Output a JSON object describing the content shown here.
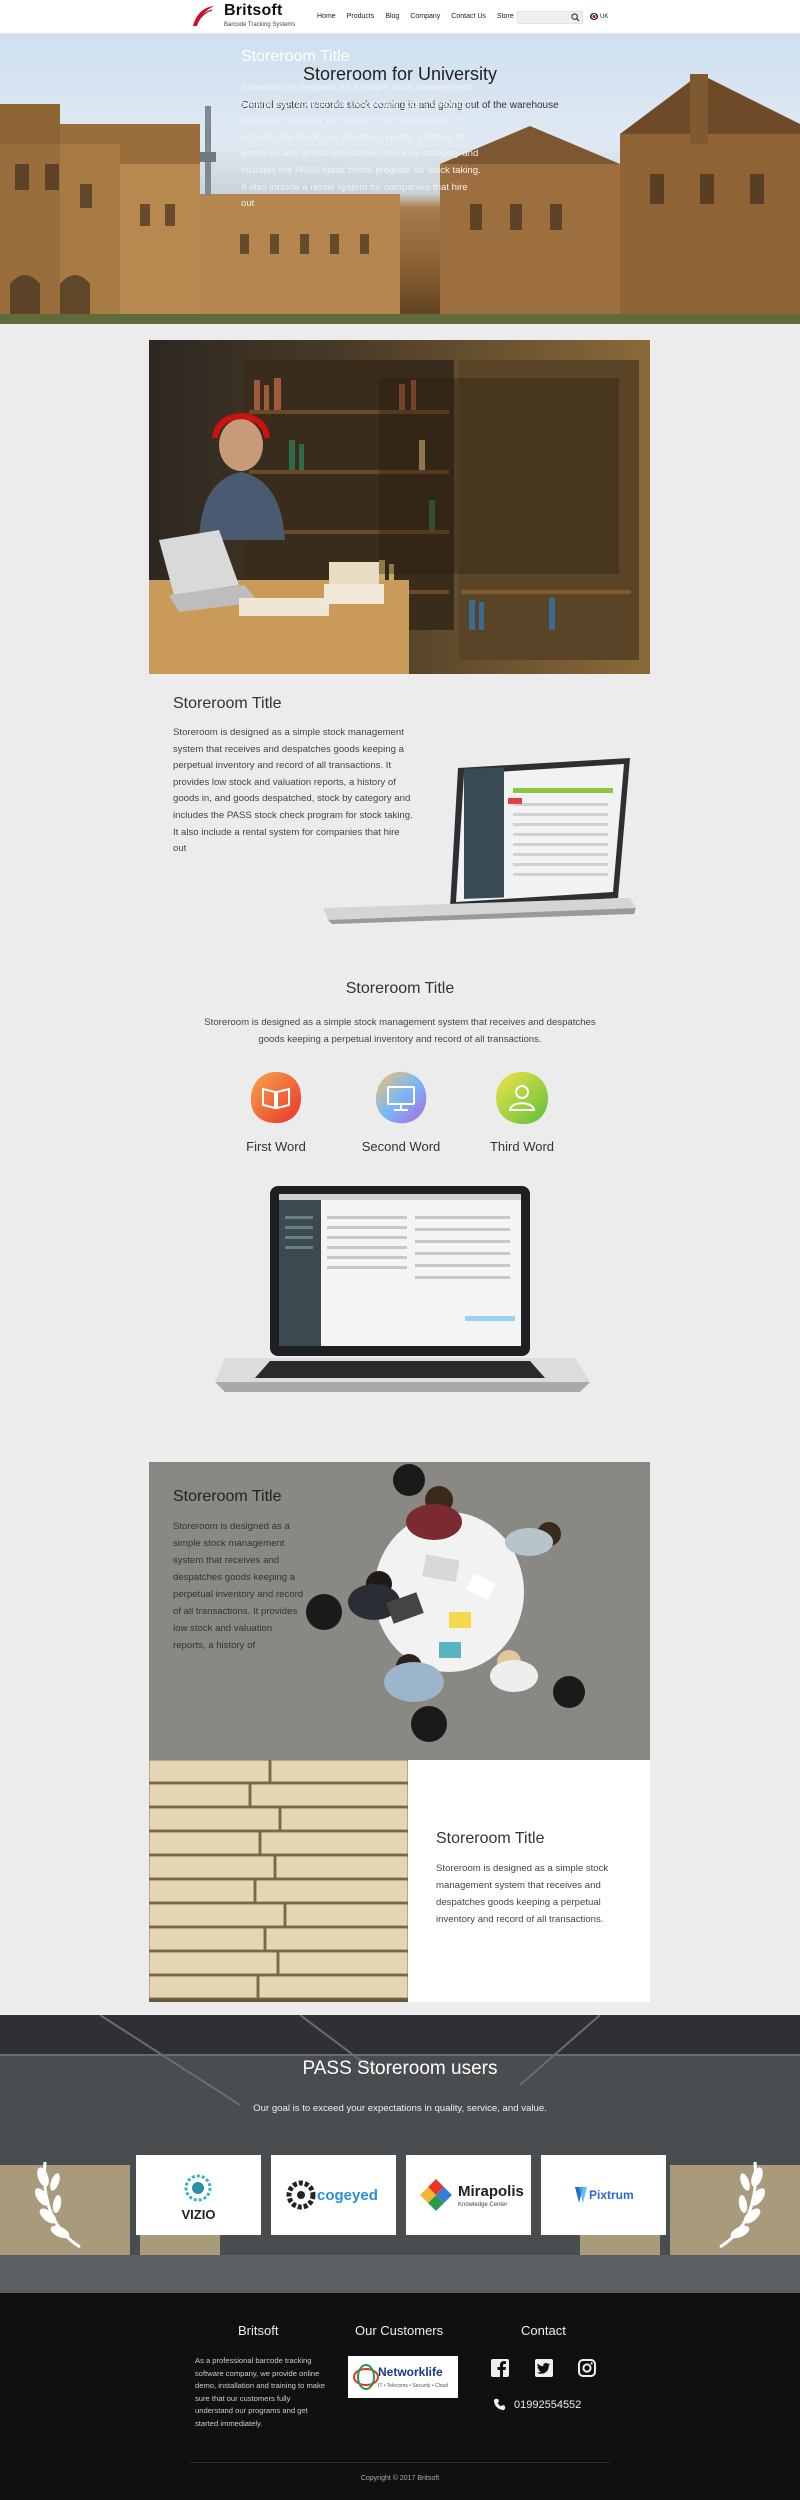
{
  "brand": {
    "name": "Britsoft",
    "tagline": "Barcode Tracking Systems"
  },
  "nav": {
    "links": [
      "Home",
      "Products",
      "Blog",
      "Company",
      "Contact Us",
      "Store"
    ],
    "search_placeholder": "",
    "language": "UK"
  },
  "hero": {
    "title": "Storeroom for University",
    "subtitle": "Control system records stock coming in and going out of the warehouse"
  },
  "section1": {
    "title": "Storeroom Title",
    "text": "Storeroom is designed as a simple stock management system that receives and despatches goods keeping a perpetual inventory and record of all transactions. It provides low stock and valuation reports, a history of goods in, and goods despatched, stock by category and includes the PASS stock check program for stock taking. It also include a rental system for companies that hire out"
  },
  "section2": {
    "title": "Storeroom Title",
    "text": "Storeroom is designed as a simple stock management system that receives and despatches goods keeping a perpetual inventory and record of all transactions. It provides low stock and valuation reports, a history of goods in, and goods despatched, stock by category and includes the PASS stock check program for stock taking. It also include a rental system for companies that hire out"
  },
  "section3": {
    "title": "Storeroom Title",
    "text": "Storeroom is designed as a simple stock management system that receives and despatches goods keeping a perpetual inventory and record of all transactions.",
    "features": [
      {
        "label": "First Word",
        "icon": "book-icon",
        "color": "#f0572a"
      },
      {
        "label": "Second Word",
        "icon": "monitor-icon",
        "color": "#6aa8f0"
      },
      {
        "label": "Third Word",
        "icon": "user-icon",
        "color": "#8cc63f"
      }
    ]
  },
  "section4": {
    "title": "Storeroom Title",
    "text": "Storeroom is designed as a simple stock management system that receives and despatches goods keeping a perpetual inventory and record of all transactions. It provides low stock and valuation reports, a history of"
  },
  "section5": {
    "title": "Storeroom Title",
    "text": "Storeroom is designed as a simple stock management system that receives and despatches goods keeping a perpetual inventory and record of all transactions."
  },
  "users": {
    "title": "PASS Storeroom users",
    "subtitle": "Our goal is to exceed your expectations in quality, service, and value.",
    "clients": [
      {
        "name": "VIZIO"
      },
      {
        "name": "cogeyed"
      },
      {
        "name": "Mirapolis",
        "sub": "Knowledge Center"
      },
      {
        "name": "Pixtrum"
      }
    ]
  },
  "footer": {
    "col1_title": "Britsoft",
    "col2_title": "Our Customers",
    "col3_title": "Contact",
    "about": "As a professional barcode tracking software company, we provide online demo, installation and training to make sure that our customers fully understand our programs and get started immediately.",
    "partner_name": "Networklife",
    "partner_sub": "IT • Telecoms • Security • Cloud",
    "phone": "01992554552",
    "copyright": "Copyright © 2017 Britsoft"
  },
  "colors": {
    "brand_red": "#c8102e",
    "footer_bg": "#101010",
    "page_bg": "#ececec"
  }
}
